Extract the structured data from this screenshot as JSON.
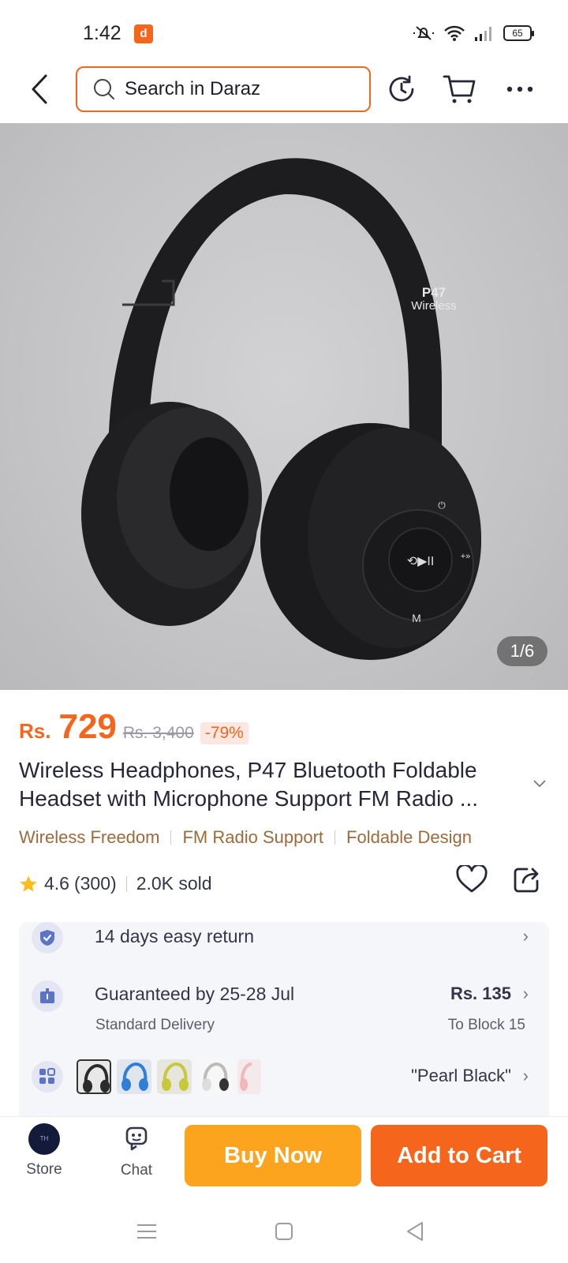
{
  "status_bar": {
    "time": "1:42",
    "battery": "65"
  },
  "header": {
    "search_placeholder": "Search in Daraz"
  },
  "gallery": {
    "counter": "1/6",
    "product_print": [
      "P47",
      "Wireless"
    ]
  },
  "price": {
    "currency": "Rs.",
    "current": "729",
    "original": "Rs. 3,400",
    "discount": "-79%"
  },
  "product": {
    "title": "Wireless Headphones, P47 Bluetooth Foldable Headset with Microphone Support FM Radio ...",
    "tags": [
      "Wireless Freedom",
      "FM Radio Support",
      "Foldable Design"
    ],
    "rating": "4.6",
    "reviews": "(300)",
    "sold": "2.0K sold"
  },
  "info": {
    "return_text": "14 days easy return",
    "delivery_text": "Guaranteed by 25-28 Jul",
    "delivery_type": "Standard Delivery",
    "delivery_price": "Rs. 135",
    "delivery_location": "To Block 15",
    "variant_selected": "\"Pearl Black\""
  },
  "variants": [
    {
      "color": "#2b2b2b"
    },
    {
      "color": "#2f7fd8"
    },
    {
      "color": "#c9c73a"
    },
    {
      "color": "#f0f0f0"
    },
    {
      "color": "#f2b6bb"
    }
  ],
  "bottom_bar": {
    "store_label": "Store",
    "chat_label": "Chat",
    "buy_now": "Buy Now",
    "add_to_cart": "Add to Cart"
  },
  "colors": {
    "accent": "#f5661c",
    "buy_now": "#fca41d",
    "tag_text": "#9b6b3c"
  },
  "icons": [
    "back-arrow-icon",
    "search-icon",
    "history-icon",
    "cart-icon",
    "more-icon",
    "star-icon",
    "heart-icon",
    "share-icon",
    "shield-icon",
    "delivery-icon",
    "variants-icon",
    "chat-icon"
  ]
}
